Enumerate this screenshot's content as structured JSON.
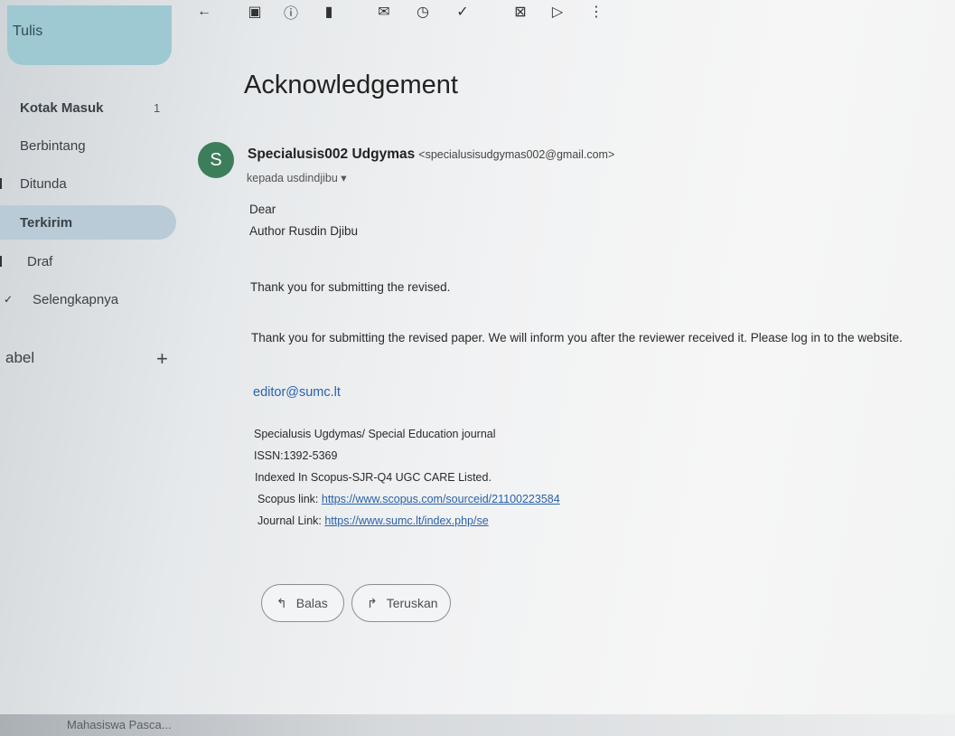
{
  "sidebar": {
    "compose_label": "Tulis",
    "items": [
      {
        "label": "Kotak Masuk",
        "count": "1"
      },
      {
        "label": "Berbintang"
      },
      {
        "label": "Ditunda"
      },
      {
        "label": "Terkirim"
      },
      {
        "label": "Draf"
      },
      {
        "label": "Selengkapnya"
      }
    ],
    "labels_heading": "abel",
    "labels_add": "+"
  },
  "toolbar": {
    "back": "←",
    "archive": "▣",
    "report": "ⓘ",
    "delete": "▮",
    "mark_unread": "✉",
    "snooze": "◷",
    "add_task": "✓",
    "move": "⊠",
    "label": "▷",
    "more": "⋮"
  },
  "message": {
    "subject": "Acknowledgement",
    "avatar_letter": "S",
    "sender_name": "Specialusis002 Udgymas",
    "sender_email": "<specialusisudgymas002@gmail.com>",
    "recipient": "kepada usdindjibu ▾",
    "body": [
      "Dear",
      "Author Rusdin Djibu",
      "Thank you for submitting the revised.",
      "Thank you for submitting the revised paper.  We will inform you after the reviewer received it. Please log in to the website."
    ],
    "signature_email": "editor@sumc.lt",
    "signature": [
      "Specialusis Ugdymas/ Special Education journal",
      "ISSN:1392-5369",
      "Indexed In Scopus-SJR-Q4 UGC CARE Listed."
    ],
    "scopus_prefix": "Scopus link: ",
    "scopus_link": "https://www.scopus.com/sourceid/21100223584",
    "journal_prefix": "Journal Link: ",
    "journal_link": "https://www.sumc.lt/index.php/se"
  },
  "actions": {
    "reply_icon": "↰",
    "reply_label": "Balas",
    "forward_icon": "↱",
    "forward_label": "Teruskan"
  },
  "taskbar": {
    "text": "Mahasiswa Pasca..."
  }
}
